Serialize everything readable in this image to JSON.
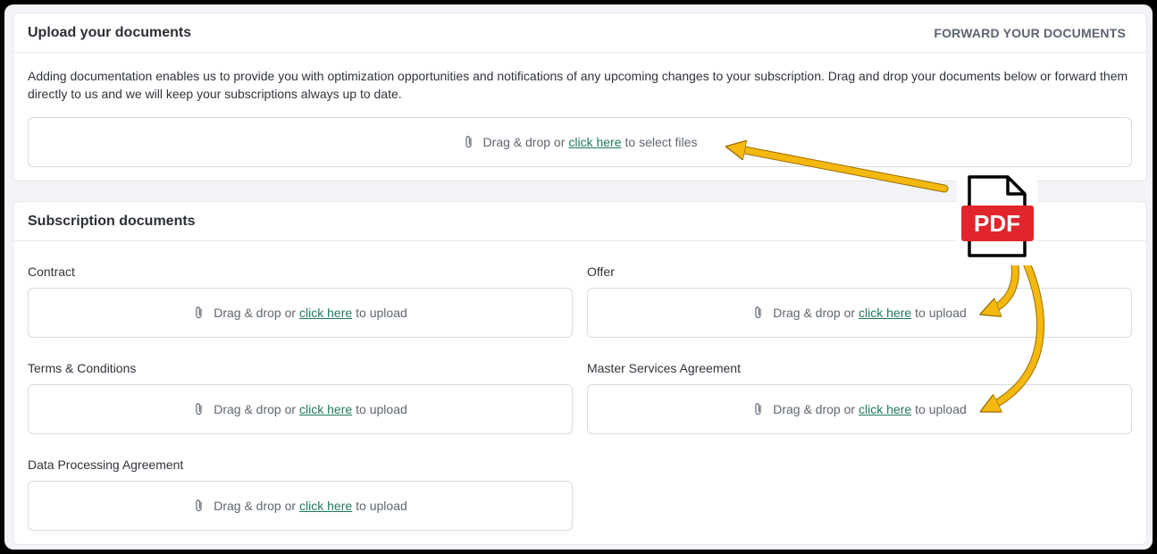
{
  "upload_card": {
    "title": "Upload your documents",
    "forward_link": "FORWARD YOUR DOCUMENTS",
    "description": "Adding documentation enables us to provide you with optimization opportunities and notifications of any upcoming changes to your subscription. Drag and drop your documents below or forward them directly to us and we will keep your subscriptions always up to date.",
    "dropzone": {
      "prefix": "Drag & drop or",
      "link": "click here",
      "suffix": "to select files"
    }
  },
  "subscription_card": {
    "title": "Subscription documents",
    "upload_prefix": "Drag & drop or",
    "upload_link": "click here",
    "upload_suffix": "to upload",
    "fields": [
      {
        "label": "Contract"
      },
      {
        "label": "Offer"
      },
      {
        "label": "Terms & Conditions"
      },
      {
        "label": "Master Services Agreement"
      },
      {
        "label": "Data Processing Agreement"
      }
    ]
  },
  "pdf_icon": {
    "label": "PDF",
    "badge_color": "#e0262c"
  },
  "colors": {
    "arrow": "#f5b80f",
    "link": "#1f7a58"
  },
  "icons": {
    "dropzone": "paperclip-icon",
    "document": "pdf-file-icon",
    "annotation": "arrow-annotation"
  }
}
